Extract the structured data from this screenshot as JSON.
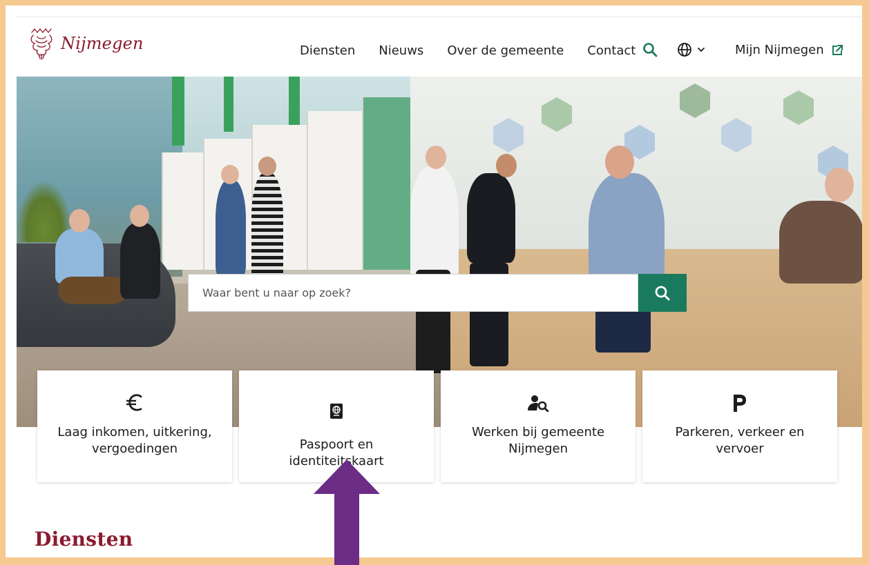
{
  "site": {
    "logo_text": "Nijmegen",
    "brand_color": "#8b1a2d",
    "accent_color": "#1a7a5d"
  },
  "nav": {
    "items": [
      "Diensten",
      "Nieuws",
      "Over de gemeente",
      "Contact"
    ],
    "search_icon": "search-icon",
    "language_icon": "globe-icon",
    "my_account_label": "Mijn Nijmegen",
    "my_account_icon": "external-link-icon"
  },
  "hero": {
    "search_placeholder": "Waar bent u naar op zoek?",
    "search_button_icon": "search-icon"
  },
  "cards": [
    {
      "icon": "euro-icon",
      "label": "Laag inkomen, uitkering, vergoedingen"
    },
    {
      "icon": "passport-icon",
      "label": "Paspoort en identiteitskaart"
    },
    {
      "icon": "user-search-icon",
      "label": "Werken bij gemeente Nijmegen"
    },
    {
      "icon": "parking-icon",
      "label": "Parkeren, verkeer en vervoer"
    }
  ],
  "sections": {
    "services_title": "Diensten"
  },
  "annotation": {
    "arrow_color": "#6b2d86",
    "frame_color": "#f5c98f"
  }
}
